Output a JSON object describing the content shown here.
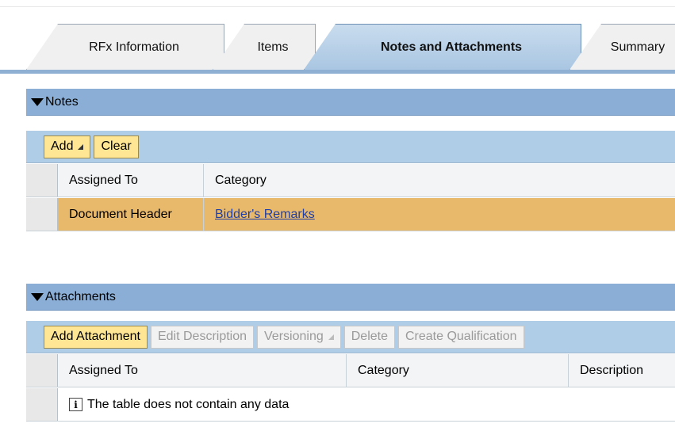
{
  "tabs": [
    {
      "label": "RFx Information",
      "active": false
    },
    {
      "label": "Items",
      "active": false
    },
    {
      "label": "Notes and Attachments",
      "active": true
    },
    {
      "label": "Summary",
      "active": false
    }
  ],
  "notes": {
    "title": "Notes",
    "toolbar": {
      "add_label": "Add",
      "clear_label": "Clear"
    },
    "columns": [
      "Assigned To",
      "Category"
    ],
    "rows": [
      {
        "assigned_to": "Document Header",
        "category": "Bidder's Remarks"
      }
    ]
  },
  "attachments": {
    "title": "Attachments",
    "toolbar": {
      "add_attachment_label": "Add Attachment",
      "edit_description_label": "Edit Description",
      "versioning_label": "Versioning",
      "delete_label": "Delete",
      "create_qualification_label": "Create Qualification"
    },
    "columns": [
      "Assigned To",
      "Category",
      "Description"
    ],
    "empty_message": "The table does not contain any data"
  },
  "colors": {
    "tab_active": "#b7d0ea",
    "panel_header": "#8aaed5",
    "toolbar": "#b0cde8",
    "button_active": "#ffe694",
    "row_highlight": "#e8b86b",
    "link": "#1f3fa6"
  },
  "icons": {
    "info": "info-icon",
    "collapse": "triangle-down-icon",
    "menu": "dropdown-arrow-icon"
  }
}
